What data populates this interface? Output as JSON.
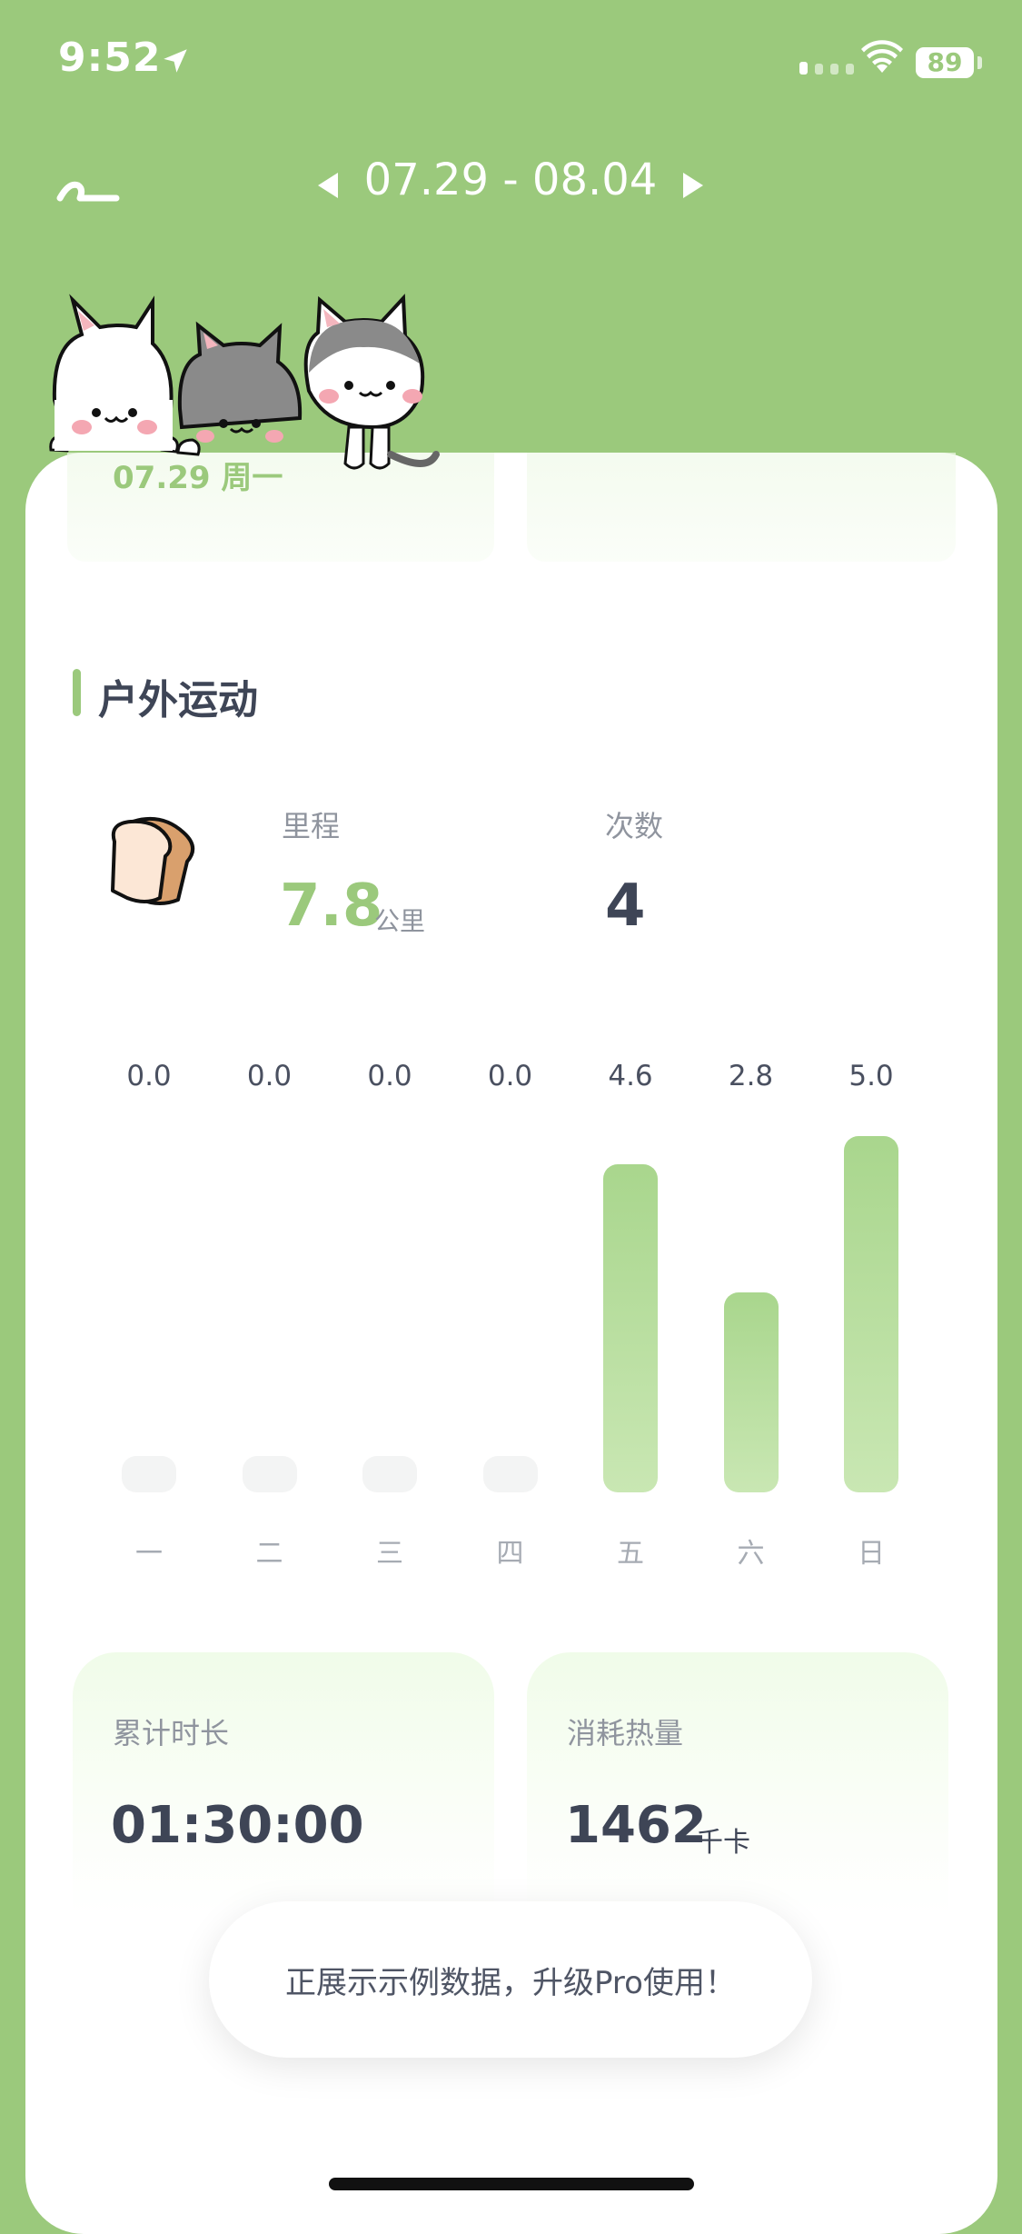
{
  "status_bar": {
    "time": "9:52",
    "battery": "89"
  },
  "header": {
    "date_range": "07.29 - 08.04"
  },
  "top_tile": {
    "day_label": "07.29 周一"
  },
  "section": {
    "title": "户外运动"
  },
  "stats": {
    "distance_label": "里程",
    "distance_value": "7.8",
    "distance_unit": "公里",
    "count_label": "次数",
    "count_value": "4"
  },
  "chart_data": {
    "type": "bar",
    "categories": [
      "一",
      "二",
      "三",
      "四",
      "五",
      "六",
      "日"
    ],
    "values": [
      0.0,
      0.0,
      0.0,
      0.0,
      4.6,
      2.8,
      5.0
    ],
    "value_labels": [
      "0.0",
      "0.0",
      "0.0",
      "0.0",
      "4.6",
      "2.8",
      "5.0"
    ],
    "ylim": [
      0,
      5.0
    ],
    "grid": false
  },
  "duration": {
    "label": "累计时长",
    "value": "01:30:00"
  },
  "calories": {
    "label": "消耗热量",
    "value": "1462",
    "unit": "千卡"
  },
  "toast": {
    "text": "正展示示例数据，升级Pro使用！"
  },
  "colors": {
    "accent": "#9BC97C",
    "text_dark": "#3E4556",
    "text_muted": "#8F949E"
  },
  "icons": [
    "location-arrow-icon",
    "wifi-icon",
    "back-icon",
    "prev-week-icon",
    "next-week-icon",
    "bread-icon",
    "cat-mascots"
  ]
}
